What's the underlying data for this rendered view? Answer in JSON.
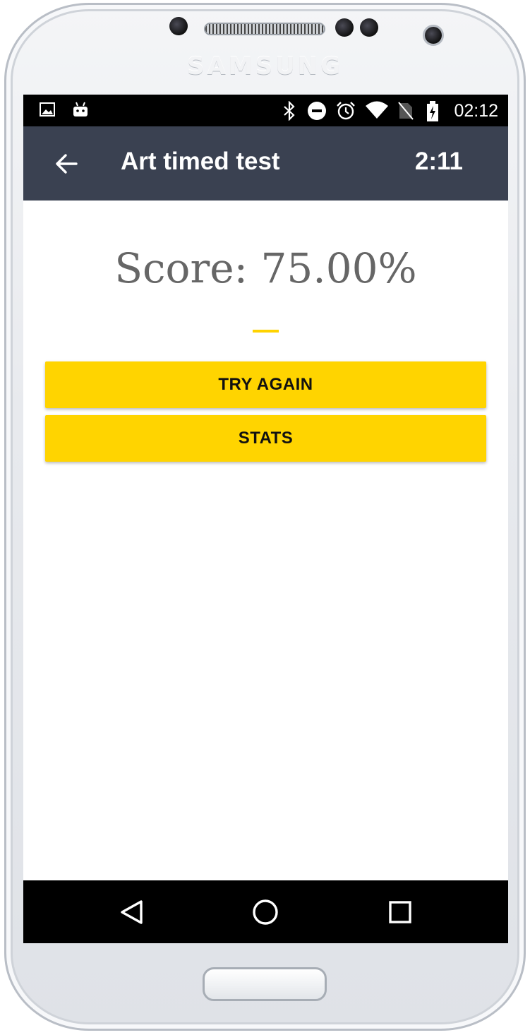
{
  "device": {
    "brand": "SAMSUNG"
  },
  "status_bar": {
    "time": "02:12",
    "icons": [
      "image-icon",
      "android-icon",
      "bluetooth-icon",
      "do-not-disturb-icon",
      "alarm-icon",
      "wifi-icon",
      "no-sim-icon",
      "battery-charging-icon"
    ]
  },
  "app_bar": {
    "title": "Art timed test",
    "timer": "2:11",
    "back_icon": "arrow-back-icon",
    "color": "#3a4151"
  },
  "result": {
    "score_text": "Score: 75.00%"
  },
  "actions": {
    "try_again_label": "TRY AGAIN",
    "stats_label": "STATS",
    "button_color": "#ffd400"
  },
  "nav_bar": {
    "icons": [
      "back-triangle-icon",
      "home-circle-icon",
      "recents-square-icon"
    ]
  }
}
